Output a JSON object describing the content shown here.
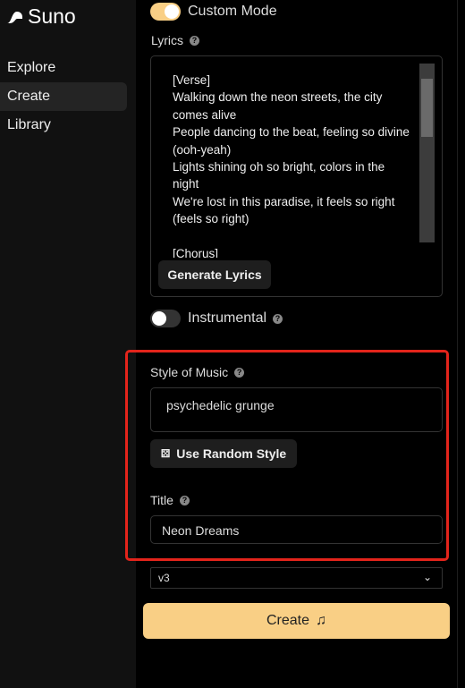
{
  "app": {
    "name": "Suno"
  },
  "sidebar": {
    "items": [
      {
        "label": "Explore"
      },
      {
        "label": "Create",
        "active": true
      },
      {
        "label": "Library"
      }
    ]
  },
  "form": {
    "custom_mode": {
      "label": "Custom Mode",
      "on": true
    },
    "lyrics": {
      "label": "Lyrics",
      "value": "[Verse]\nWalking down the neon streets, the city comes alive\nPeople dancing to the beat, feeling so divine (ooh-yeah)\nLights shining oh so bright, colors in the night\nWe're lost in this paradise, it feels so right (feels so right)\n\n[Chorus]",
      "generate_label": "Generate Lyrics"
    },
    "instrumental": {
      "label": "Instrumental",
      "on": false
    },
    "style": {
      "label": "Style of Music",
      "value": "psychedelic grunge",
      "random_label": "Use Random Style"
    },
    "title": {
      "label": "Title",
      "value": "Neon Dreams"
    },
    "version": {
      "value": "v3"
    },
    "create_label": "Create"
  },
  "colors": {
    "accent": "#f9cf85",
    "highlight": "#e3241b"
  }
}
